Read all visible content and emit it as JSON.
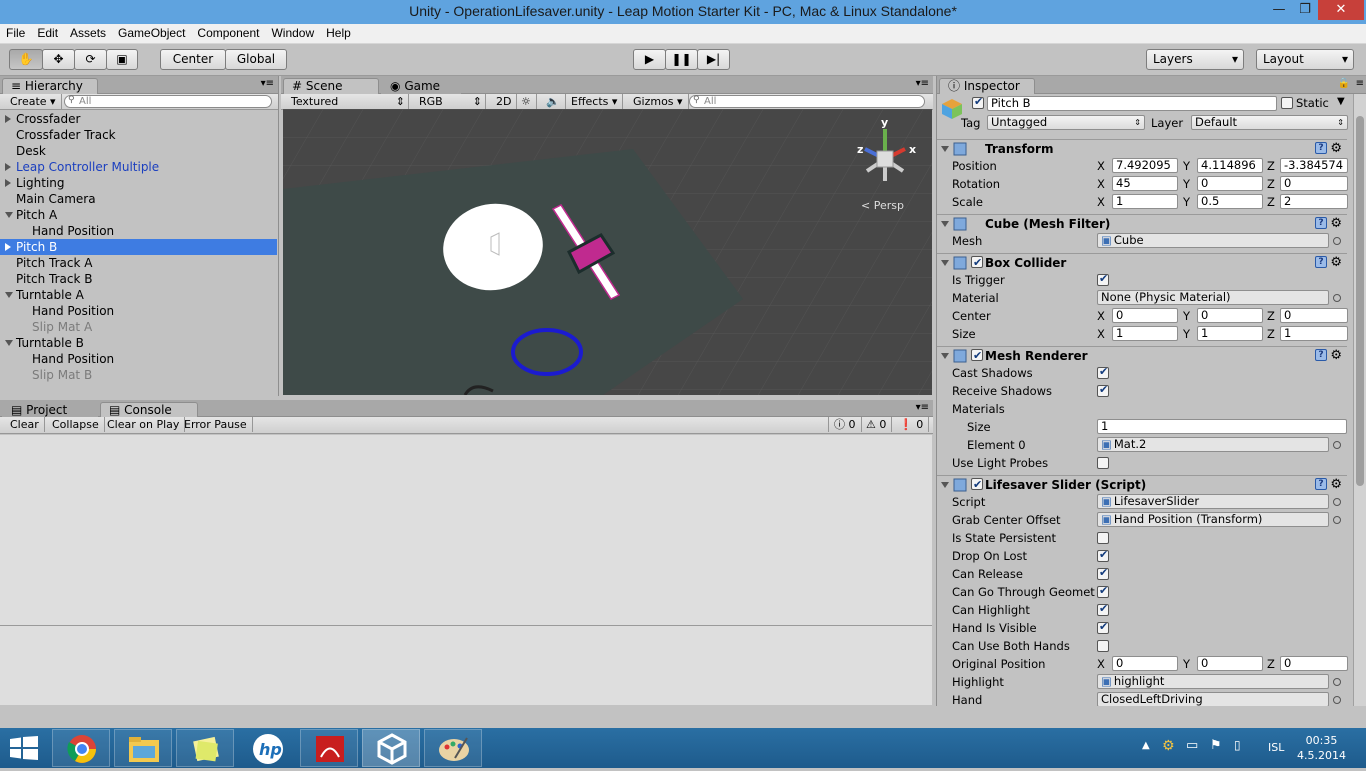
{
  "window": {
    "title": "Unity - OperationLifesaver.unity - Leap Motion Starter Kit - PC, Mac & Linux Standalone*"
  },
  "menu": [
    "File",
    "Edit",
    "Assets",
    "GameObject",
    "Component",
    "Window",
    "Help"
  ],
  "toolbar": {
    "pivot": "Center",
    "space": "Global",
    "layers": "Layers",
    "layout": "Layout"
  },
  "hierarchy": {
    "tab": "Hierarchy",
    "create": "Create",
    "search": "All",
    "items": [
      {
        "label": "Crossfader",
        "indent": 0,
        "arrow": true,
        "style": ""
      },
      {
        "label": "Crossfader Track",
        "indent": 0,
        "arrow": false,
        "style": ""
      },
      {
        "label": "Desk",
        "indent": 0,
        "arrow": false,
        "style": ""
      },
      {
        "label": "Leap Controller Multiple",
        "indent": 0,
        "arrow": true,
        "style": "blue"
      },
      {
        "label": "Lighting",
        "indent": 0,
        "arrow": true,
        "style": ""
      },
      {
        "label": "Main Camera",
        "indent": 0,
        "arrow": false,
        "style": ""
      },
      {
        "label": "Pitch A",
        "indent": 0,
        "arrow": true,
        "style": "open"
      },
      {
        "label": "Hand Position",
        "indent": 1,
        "arrow": false,
        "style": ""
      },
      {
        "label": "Pitch B",
        "indent": 0,
        "arrow": true,
        "style": "sel"
      },
      {
        "label": "Pitch Track A",
        "indent": 0,
        "arrow": false,
        "style": ""
      },
      {
        "label": "Pitch Track B",
        "indent": 0,
        "arrow": false,
        "style": ""
      },
      {
        "label": "Turntable A",
        "indent": 0,
        "arrow": true,
        "style": "open"
      },
      {
        "label": "Hand Position",
        "indent": 1,
        "arrow": false,
        "style": ""
      },
      {
        "label": "Slip Mat A",
        "indent": 1,
        "arrow": false,
        "style": "gray"
      },
      {
        "label": "Turntable B",
        "indent": 0,
        "arrow": true,
        "style": "open"
      },
      {
        "label": "Hand Position",
        "indent": 1,
        "arrow": false,
        "style": ""
      },
      {
        "label": "Slip Mat B",
        "indent": 1,
        "arrow": false,
        "style": "gray"
      }
    ]
  },
  "scene": {
    "tab_scene": "Scene",
    "tab_game": "Game",
    "draw_mode": "Textured",
    "render_mode": "RGB",
    "mode_2d": "2D",
    "effects": "Effects",
    "gizmos": "Gizmos",
    "search": "All",
    "persp": "Persp",
    "axis_y": "y",
    "axis_x": "x",
    "axis_z": "z"
  },
  "console": {
    "tab_project": "Project",
    "tab_console": "Console",
    "clear": "Clear",
    "collapse": "Collapse",
    "clear_on_play": "Clear on Play",
    "error_pause": "Error Pause",
    "count_info": "0",
    "count_warn": "0",
    "count_error": "0"
  },
  "inspector": {
    "tab": "Inspector",
    "name": "Pitch B",
    "static": "Static",
    "tag_label": "Tag",
    "tag": "Untagged",
    "layer_label": "Layer",
    "layer": "Default",
    "transform": {
      "title": "Transform",
      "position": {
        "label": "Position",
        "x": "7.492095",
        "y": "4.114896",
        "z": "-3.384574"
      },
      "rotation": {
        "label": "Rotation",
        "x": "45",
        "y": "0",
        "z": "0"
      },
      "scale": {
        "label": "Scale",
        "x": "1",
        "y": "0.5",
        "z": "2"
      }
    },
    "mesh_filter": {
      "title": "Cube (Mesh Filter)",
      "mesh_label": "Mesh",
      "mesh": "Cube"
    },
    "box_collider": {
      "title": "Box Collider",
      "is_trigger": "Is Trigger",
      "material_label": "Material",
      "material": "None (Physic Material)",
      "center": {
        "label": "Center",
        "x": "0",
        "y": "0",
        "z": "0"
      },
      "size": {
        "label": "Size",
        "x": "1",
        "y": "1",
        "z": "1"
      }
    },
    "mesh_renderer": {
      "title": "Mesh Renderer",
      "cast_shadows": "Cast Shadows",
      "receive_shadows": "Receive Shadows",
      "materials": "Materials",
      "size_label": "Size",
      "size": "1",
      "element0_label": "Element 0",
      "element0": "Mat.2",
      "use_light_probes": "Use Light Probes"
    },
    "script": {
      "title": "Lifesaver Slider (Script)",
      "script_label": "Script",
      "script": "LifesaverSlider",
      "grab_label": "Grab Center Offset",
      "grab": "Hand Position (Transform)",
      "bools": [
        {
          "label": "Is State Persistent",
          "on": false
        },
        {
          "label": "Drop On Lost",
          "on": true
        },
        {
          "label": "Can Release",
          "on": true
        },
        {
          "label": "Can Go Through Geomet",
          "on": true
        },
        {
          "label": "Can Highlight",
          "on": true
        },
        {
          "label": "Hand Is Visible",
          "on": true
        },
        {
          "label": "Can Use Both Hands",
          "on": false
        }
      ],
      "orig": {
        "label": "Original Position",
        "x": "0",
        "y": "0",
        "z": "0"
      },
      "highlight_label": "Highlight",
      "highlight": "highlight",
      "hand_label": "Hand",
      "hand": "ClosedLeftDriving"
    },
    "xl": "X",
    "yl": "Y",
    "zl": "Z"
  },
  "taskbar": {
    "lang": "ISL",
    "time": "00:35",
    "date": "4.5.2014"
  }
}
